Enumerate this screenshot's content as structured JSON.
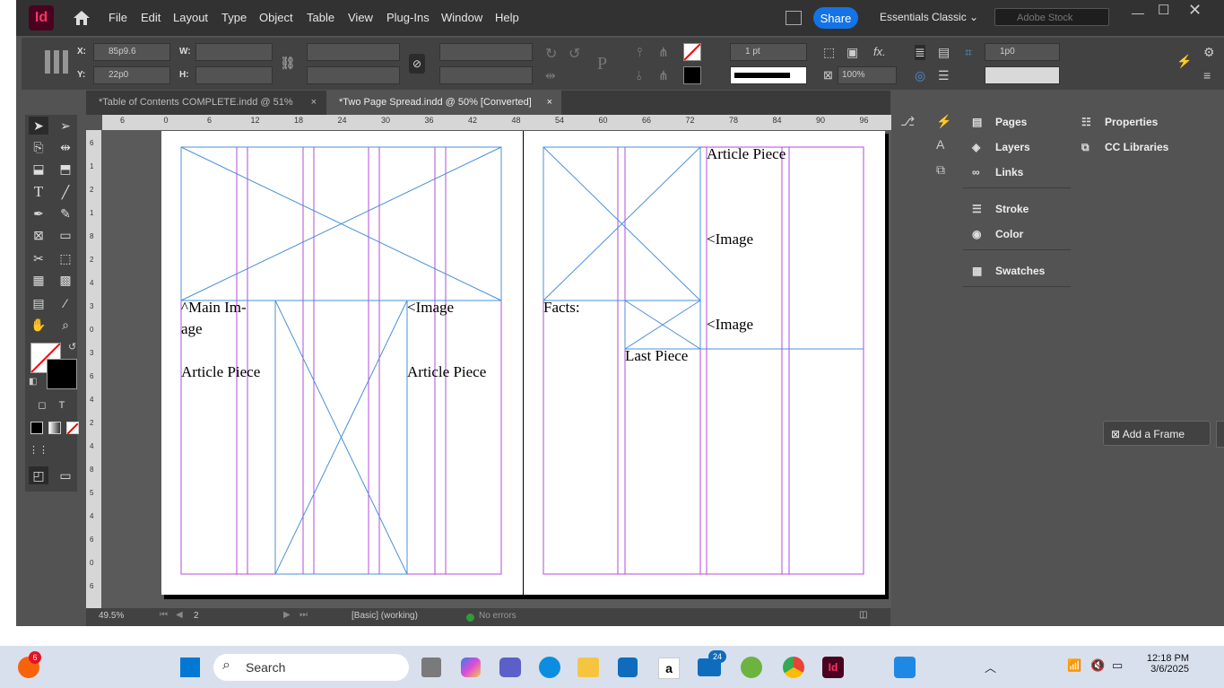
{
  "app": {
    "logo": "Id"
  },
  "menu": [
    "File",
    "Edit",
    "Layout",
    "Type",
    "Object",
    "Table",
    "View",
    "Plug-Ins",
    "Window",
    "Help"
  ],
  "header": {
    "share_label": "Share",
    "workspace": "Essentials Classic",
    "stock_placeholder": "Adobe Stock"
  },
  "control": {
    "x_label": "X:",
    "x_value": "85p9.6",
    "y_label": "Y:",
    "y_value": "22p0",
    "w_label": "W:",
    "h_label": "H:",
    "stroke_weight": "1 pt",
    "opacity": "100%",
    "gap": "1p0"
  },
  "tabs": [
    {
      "label": "*Table of Contents COMPLETE.indd @ 51%",
      "close": "×"
    },
    {
      "label": "*Two Page Spread.indd @ 50% [Converted]",
      "close": "×"
    }
  ],
  "ruler_top": [
    "6",
    "0",
    "6",
    "12",
    "18",
    "24",
    "30",
    "36",
    "42",
    "48",
    "54",
    "60",
    "66",
    "72",
    "78",
    "84",
    "90",
    "96"
  ],
  "ruler_left": [
    "6",
    "1",
    "2",
    "1",
    "8",
    "2",
    "4",
    "3",
    "0",
    "3",
    "6",
    "4",
    "2",
    "4",
    "8",
    "5",
    "4",
    "6",
    "0",
    "6"
  ],
  "page_text": {
    "left_main_image": "^Main Im-\nage",
    "left_article_1": "Article Piece",
    "left_image": "<Image",
    "left_article_2": "Article Piece",
    "right_article": "Article Piece",
    "right_image_1": "<Image",
    "right_facts": "Facts:",
    "right_image_2": "<Image",
    "right_last_piece": "Last Piece"
  },
  "status": {
    "zoom": "49.5%",
    "page": "2",
    "style": "[Basic] (working)",
    "errors": "No errors"
  },
  "panels": {
    "list": [
      {
        "icon": "pages-icon",
        "label": "Pages"
      },
      {
        "icon": "layers-icon",
        "label": "Layers"
      },
      {
        "icon": "links-icon",
        "label": "Links"
      },
      {
        "icon": "stroke-icon",
        "label": "Stroke"
      },
      {
        "icon": "color-icon",
        "label": "Color"
      },
      {
        "icon": "swatches-icon",
        "label": "Swatches"
      }
    ],
    "properties_label": "Properties",
    "cc_libraries_label": "CC Libraries",
    "add_frame_label": "Add a Frame"
  },
  "taskbar": {
    "search_placeholder": "Search",
    "time": "12:18 PM",
    "date": "3/6/2025",
    "badge_left": "6",
    "badge_mail": "24"
  },
  "colors": {
    "accent": "#1473e6",
    "margin_guide": "#b44bdb",
    "frame_edge": "#4a90d9",
    "indesign_brand": "#ff3366"
  }
}
